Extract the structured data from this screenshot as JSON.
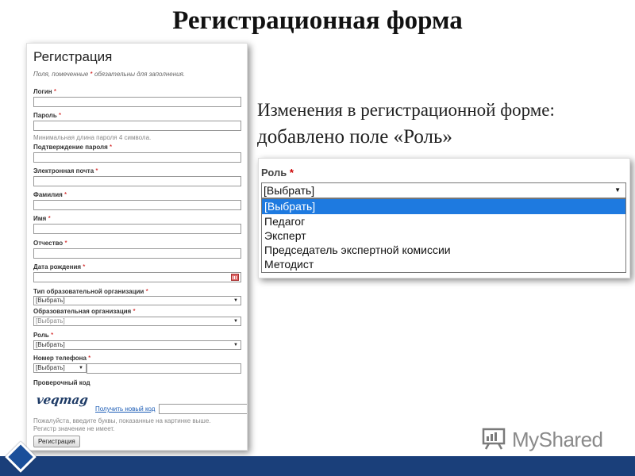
{
  "slide": {
    "title": "Регистрационная форма",
    "description_line1": "Изменения в регистрационной форме:",
    "description_line2": "добавлено поле «Роль»"
  },
  "form": {
    "heading": "Регистрация",
    "note_before": "Поля, помеченные ",
    "note_star": "*",
    "note_after": " обязательны для заполнения.",
    "required_mark": "*",
    "fields": {
      "login": "Логин",
      "password": "Пароль",
      "password_hint": "Минимальная длина пароля 4 символа.",
      "password_confirm": "Подтверждение пароля",
      "email": "Электронная почта",
      "last_name": "Фамилия",
      "first_name": "Имя",
      "patronymic": "Отчество",
      "birth_date": "Дата рождения",
      "org_type": "Тип образовательной организации",
      "org": "Образовательная организация",
      "role": "Роль",
      "phone": "Номер телефона",
      "captcha": "Проверочный код"
    },
    "select_placeholder": "[Выбрать]",
    "captcha_image_text": "veqmag",
    "new_code_link": "Получить новый код",
    "captcha_hint_line1": "Пожалуйста, введите буквы, показанные на картинке выше.",
    "captcha_hint_line2": "Регистр значение не имеет.",
    "submit_button": "Регистрация"
  },
  "role_dropdown": {
    "label": "Роль",
    "required_mark": "*",
    "current_value": "[Выбрать]",
    "options": [
      "[Выбрать]",
      "Педагог",
      "Эксперт",
      "Председатель экспертной комиссии",
      "Методист"
    ],
    "selected_index": 0
  },
  "logo": {
    "text": "MyShared"
  },
  "colors": {
    "footer_bar": "#1a3f7a",
    "required_star": "#cc0000",
    "highlight": "#1e7ae0",
    "link": "#1a5bb5"
  }
}
